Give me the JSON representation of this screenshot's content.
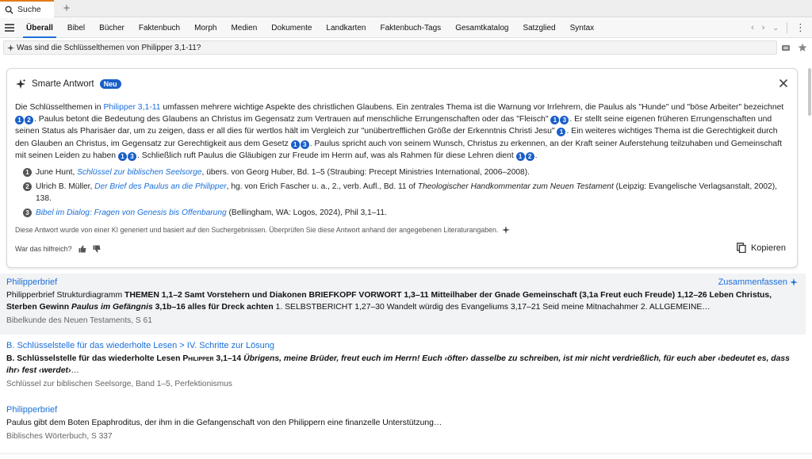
{
  "tab": {
    "label": "Suche"
  },
  "nav": [
    "Überall",
    "Bibel",
    "Bücher",
    "Faktenbuch",
    "Morph",
    "Medien",
    "Dokumente",
    "Landkarten",
    "Faktenbuch-Tags",
    "Gesamtkatalog",
    "Satzglied",
    "Syntax"
  ],
  "search": {
    "value": "Was sind die Schlüsselthemen von Philipper 3,1-11?"
  },
  "card": {
    "title": "Smarte Antwort",
    "badge": "Neu",
    "answer": {
      "s1a": "Die Schlüsselthemen in ",
      "s1link": "Philipper 3,1-11",
      "s1b": " umfassen mehrere wichtige Aspekte des christlichen Glaubens. Ein zentrales Thema ist die Warnung vor Irrlehrern, die Paulus als \"Hunde\" und \"böse Arbeiter\" bezeichnet",
      "s2": ". Paulus betont die Bedeutung des Glaubens an Christus im Gegensatz zum Vertrauen auf menschliche Errungenschaften oder das \"Fleisch\"",
      "s3": ". Er stellt seine eigenen früheren Errungenschaften und seinen Status als Pharisäer dar, um zu zeigen, dass er all dies für wertlos hält im Vergleich zur \"unübertrefflichen Größe der Erkenntnis Christi Jesu\"",
      "s4": ". Ein weiteres wichtiges Thema ist die Gerechtigkeit durch den Glauben an Christus, im Gegensatz zur Gerechtigkeit aus dem Gesetz",
      "s5": ". Paulus spricht auch von seinem Wunsch, Christus zu erkennen, an der Kraft seiner Auferstehung teilzuhaben und Gemeinschaft mit seinen Leiden zu haben",
      "s6": ". Schließlich ruft Paulus die Gläubigen zur Freude im Herrn auf, was als Rahmen für diese Lehren dient",
      "s7": "."
    },
    "refnums": [
      "1",
      "2",
      "3"
    ],
    "references": {
      "r1a": "June Hunt, ",
      "r1t": "Schlüssel zur biblischen Seelsorge",
      "r1b": ", übers. von Georg Huber, Bd. 1–5 (Straubing: Precept Ministries International, 2006–2008).",
      "r2a": "Ulrich B. Müller, ",
      "r2t": "Der Brief des Paulus an die Philipper",
      "r2b": ", hg. von Erich Fascher u. a., 2., verb. Aufl., Bd. 11 of ",
      "r2s": "Theologischer Handkommentar zum Neuen Testament",
      "r2c": " (Leipzig: Evangelische Verlagsanstalt, 2002), 138.",
      "r3t": "Bibel im Dialog: Fragen von Genesis bis Offenbarung",
      "r3b": " (Bellingham, WA: Logos, 2024), Phil 3,1–11."
    },
    "disclaimer": "Diese Antwort wurde von einer KI generiert und basiert auf den Suchergebnissen. Überprüfen Sie diese Antwort anhand der angegebenen Literaturangaben.",
    "feedback_label": "War das hilfreich?",
    "copy_label": "Kopieren"
  },
  "results": [
    {
      "title": "Philipperbrief",
      "summarize_label": "Zusammenfassen",
      "b1": "Philipperbrief Strukturdiagramm ",
      "b2": "THEMEN 1,1–2 Samt Vorstehern und Diakonen BRIEFKOPF VORWORT 1,3–11 Mitteilhaber der Gnade Gemeinschaft (3,1a Freut euch Freude) 1,12–26 Leben Christus, Sterben Gewinn ",
      "b3": "Paulus im Gefängnis",
      "b4": " 3,1b–16 alles für Dreck achten",
      "b5": " 1. SELBSTBERICHT 1,27–30 Wandelt würdig des Evangeliums 3,17–21 Seid meine Mitnachahmer 2. ALLGEMEINE…",
      "source": "Bibelkunde des Neuen Testaments, S 61"
    },
    {
      "title": "B. Schlüsselstelle für das wiederholte Lesen > IV. Schritte zur Lösung",
      "b1": "B. Schlüsselstelle für das wiederholte Lesen ",
      "b2": "Philipper",
      "b3": " 3,1–14 ",
      "b4": "Übrigens, meine Brüder, freut euch im Herrn! Euch ‹öfter› dasselbe zu schreiben, ist mir nicht verdrießlich, für euch aber ‹bedeutet es, dass ihr› fest ‹werdet›",
      "b5": "…",
      "source": "Schlüssel zur biblischen Seelsorge, Band 1–5, Perfektionismus"
    },
    {
      "title": "Philipperbrief",
      "b1": "Paulus gibt dem Boten Epaphroditus, der ihm in die Gefangenschaft von den Philippern eine finanzelle Unterstützung…",
      "source": "Biblisches Wörterbuch, S 337"
    }
  ]
}
